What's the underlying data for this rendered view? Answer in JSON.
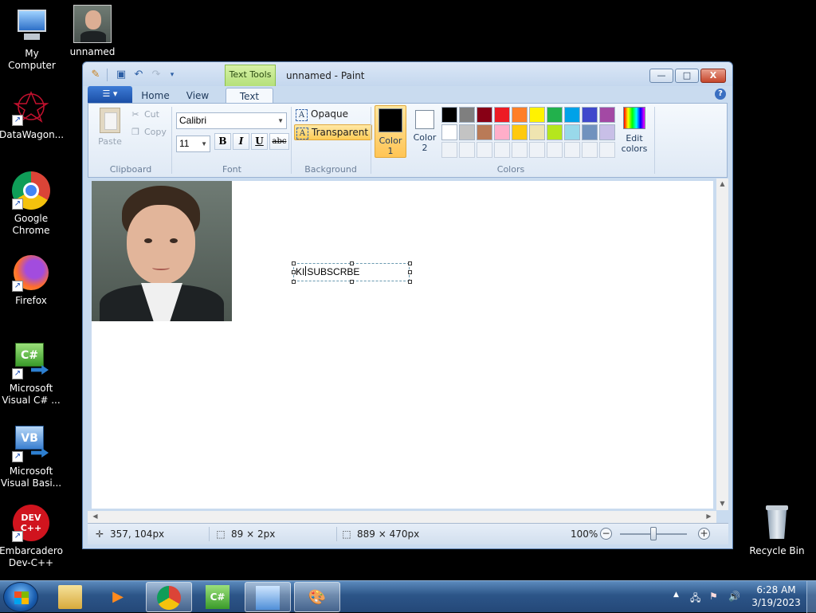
{
  "desktop": {
    "icons": [
      {
        "label": "My Computer"
      },
      {
        "label": "unnamed"
      },
      {
        "label": "DataWagon..."
      },
      {
        "label": "Google Chrome"
      },
      {
        "label": "Firefox"
      },
      {
        "label": "Microsoft Visual C# ..."
      },
      {
        "label": "Microsoft Visual Basi..."
      },
      {
        "label": "Embarcadero Dev-C++"
      },
      {
        "label": "Recycle Bin"
      }
    ]
  },
  "window": {
    "title": "unnamed - Paint",
    "contextual_tab": "Text Tools",
    "min_glyph": "—",
    "max_glyph": "□",
    "close_glyph": "X"
  },
  "ribbon": {
    "tabs": [
      {
        "label": "Home",
        "active": false
      },
      {
        "label": "View",
        "active": false
      },
      {
        "label": "Text",
        "active": true
      }
    ],
    "clipboard": {
      "paste": "Paste",
      "cut": "Cut",
      "copy": "Copy",
      "group": "Clipboard"
    },
    "font": {
      "family": "Calibri",
      "size": "11",
      "bold": "B",
      "italic": "I",
      "underline": "U",
      "strike": "abc",
      "group": "Font"
    },
    "background": {
      "opaque": "Opaque",
      "transparent": "Transparent",
      "selected": "transparent",
      "group": "Background"
    },
    "colors": {
      "color1_label": "Color 1",
      "color2_label": "Color 2",
      "color1": "#000000",
      "color2": "#ffffff",
      "palette_row1": [
        "#000000",
        "#7f7f7f",
        "#880015",
        "#ed1c24",
        "#ff7f27",
        "#fff200",
        "#22b14c",
        "#00a2e8",
        "#3f48cc",
        "#a349a4"
      ],
      "palette_row2": [
        "#ffffff",
        "#c3c3c3",
        "#b97a57",
        "#ffaec9",
        "#ffc90e",
        "#efe4b0",
        "#b5e61d",
        "#99d9ea",
        "#7092be",
        "#c8bfe7"
      ],
      "edit_colors": "Edit colors",
      "group": "Colors"
    }
  },
  "canvas": {
    "text_box_before_caret": "KI",
    "text_box_after_caret": "SUBSCRBE"
  },
  "statusbar": {
    "cursor_pos": "357, 104px",
    "selection_size": "89 × 2px",
    "image_size": "889 × 470px",
    "zoom": "100%"
  },
  "taskbar": {
    "clock_time": "6:28 AM",
    "clock_date": "3/19/2023"
  }
}
